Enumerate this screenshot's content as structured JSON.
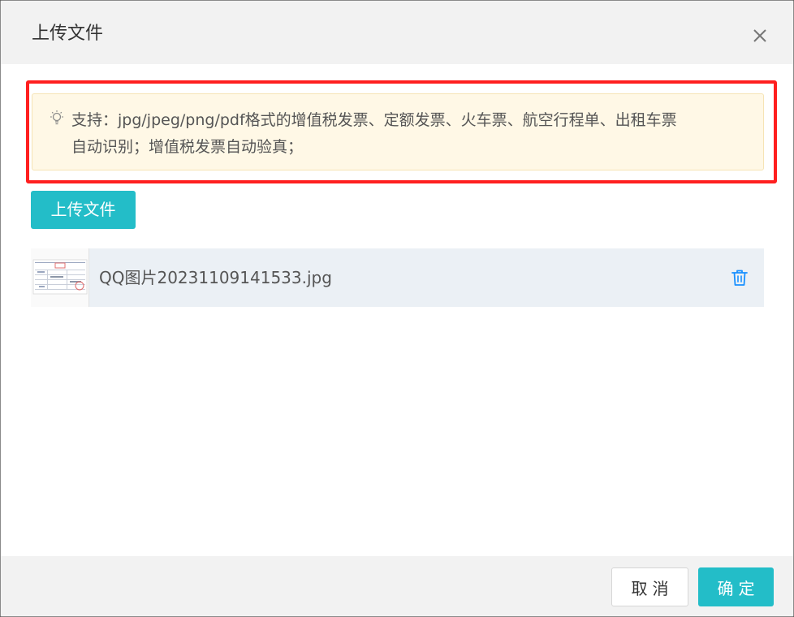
{
  "dialog": {
    "title": "上传文件",
    "close_icon": "close-icon"
  },
  "notice": {
    "icon": "lightbulb-icon",
    "line1": "支持：jpg/jpeg/png/pdf格式的增值税发票、定额发票、火车票、航空行程单、出租车票",
    "line2": "自动识别；增值税发票自动验真；",
    "highlight_color": "#ff1f1f",
    "background_color": "#fff8e6"
  },
  "upload_button": {
    "label": "上传文件"
  },
  "files": [
    {
      "name": "QQ图片20231109141533.jpg",
      "thumbnail_icon": "invoice-thumbnail",
      "delete_icon": "trash-icon"
    }
  ],
  "footer": {
    "cancel_label": "取消",
    "ok_label": "确定"
  },
  "colors": {
    "accent": "#23bdc8",
    "delete_icon": "#1890ff",
    "file_row_bg": "#ebf0f5"
  }
}
